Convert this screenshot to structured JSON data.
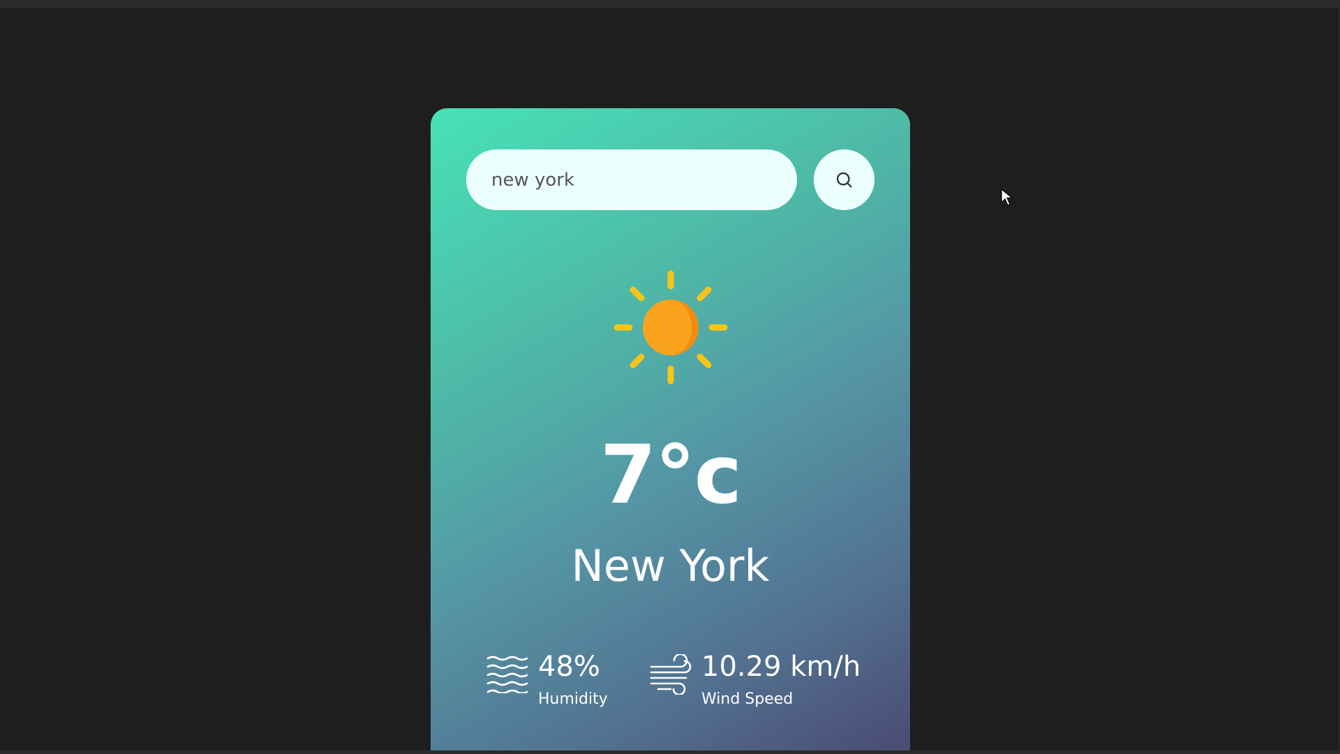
{
  "search": {
    "value": "new york",
    "icon": "search-icon"
  },
  "weather": {
    "icon": "sun-icon",
    "temperature": "7°c",
    "city": "New York"
  },
  "details": {
    "humidity": {
      "value": "48%",
      "label": "Humidity",
      "icon": "humidity-icon"
    },
    "wind": {
      "value": "10.29 km/h",
      "label": "Wind Speed",
      "icon": "wind-icon"
    }
  },
  "colors": {
    "background": "#1e1e1e",
    "card_gradient_start": "#47e2b8",
    "card_gradient_end": "#4a4a72",
    "sun_rays": "#f5c518",
    "sun_core": "#f9a41c",
    "input_bg": "#ebfffc"
  }
}
